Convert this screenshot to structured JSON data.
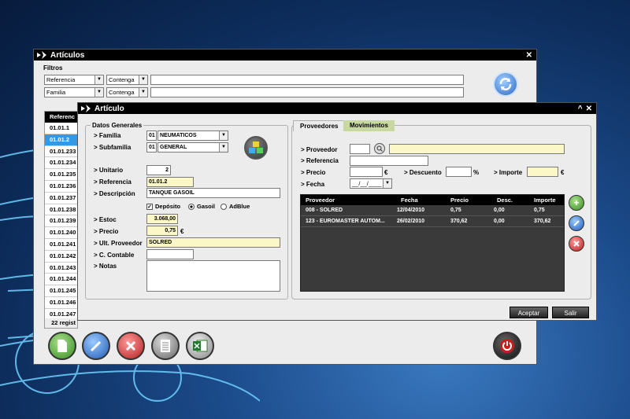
{
  "articulos": {
    "title": "Artículos",
    "filters_label": "Filtros",
    "filter1": {
      "field": "Referencia",
      "op": "Contenga"
    },
    "filter2": {
      "field": "Familia",
      "op": "Contenga"
    },
    "list_header": "Referenc",
    "list": [
      "01.01.1",
      "01.01.2",
      "01.01.233",
      "01.01.234",
      "01.01.235",
      "01.01.236",
      "01.01.237",
      "01.01.238",
      "01.01.239",
      "01.01.240",
      "01.01.241",
      "01.01.242",
      "01.01.243",
      "01.01.244",
      "01.01.245",
      "01.01.246",
      "01.01.247"
    ],
    "count": "22 regist"
  },
  "articulo": {
    "title": "Artículo",
    "datos_generales": "Datos Generales",
    "familia": {
      "label": "> Familia",
      "code": "01",
      "name": "NEUMATICOS"
    },
    "subfamilia": {
      "label": "> Subfamilia",
      "code": "01",
      "name": "GENERAL"
    },
    "unitario": {
      "label": "> Unitario",
      "value": "2"
    },
    "referencia": {
      "label": "> Referencia",
      "value": "01.01.2"
    },
    "descripcion": {
      "label": "> Descripción",
      "value": "TANQUE GASOIL"
    },
    "deposito": "Depósito",
    "gasoil": "Gasoil",
    "adblue": "AdBlue",
    "estoc": {
      "label": "> Estoc",
      "value": "3.068,00"
    },
    "precio": {
      "label": "> Precio",
      "value": "0,75",
      "unit": "€"
    },
    "ult_proveedor": {
      "label": "> Ult. Proveedor",
      "value": "SOLRED"
    },
    "c_contable": {
      "label": "> C. Contable",
      "value": ""
    },
    "notas": {
      "label": "> Notas",
      "value": ""
    },
    "tabs": {
      "proveedores": "Proveedores",
      "movimientos": "Movimientos"
    },
    "prov": {
      "proveedor": "> Proveedor",
      "referencia": "> Referencia",
      "precio": "> Precio",
      "euro": "€",
      "descuento": "> Descuento",
      "pct": "%",
      "importe": "> Importe",
      "fecha": "> Fecha",
      "fecha_val": "__/__/____"
    },
    "grid": {
      "headers": [
        "Proveedor",
        "Fecha",
        "Precio",
        "Desc.",
        "Importe"
      ],
      "rows": [
        [
          "008 - SOLRED",
          "12/04/2010",
          "0,75",
          "0,00",
          "0,75"
        ],
        [
          "123 - EUROMASTER AUTOM...",
          "26/02/2010",
          "370,62",
          "0,00",
          "370,62"
        ]
      ]
    },
    "aceptar": "Aceptar",
    "salir": "Salir"
  },
  "colors": {
    "accent": "#3399e6",
    "green": "#4fa63a",
    "blue": "#2f68c4",
    "red": "#c62b2b"
  }
}
